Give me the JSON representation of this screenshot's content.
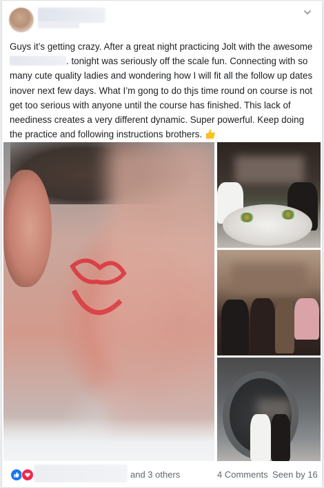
{
  "post": {
    "text_part1": "Guys it’s getting crazy. After a great night practicing Jolt with the awesome ",
    "text_part2": ". tonight was seriously off the scale fun. Connecting with so many cute quality ladies and wondering how I will fit all the follow up dates inover next few days. What I’m gong to do thjs time round on course is not get too serious with anyone until the course has finished. This lack of neediness creates a very different dynamic. Super powerful. Keep doing the practice and following instructions brothers. ",
    "emoji_end": "🙌"
  },
  "icons": {
    "chevron": "chevron-down-icon",
    "thumbs": "thumbs-up-emoji-icon",
    "like": "like-reaction-icon",
    "love": "love-reaction-icon"
  },
  "footer": {
    "others": "and 3 others",
    "comments": "4 Comments",
    "seen": "Seen by 16"
  },
  "colors": {
    "accent_blue": "#1877f2",
    "love_red": "#f0284a",
    "text": "#1c1e21",
    "muted": "#606770"
  }
}
